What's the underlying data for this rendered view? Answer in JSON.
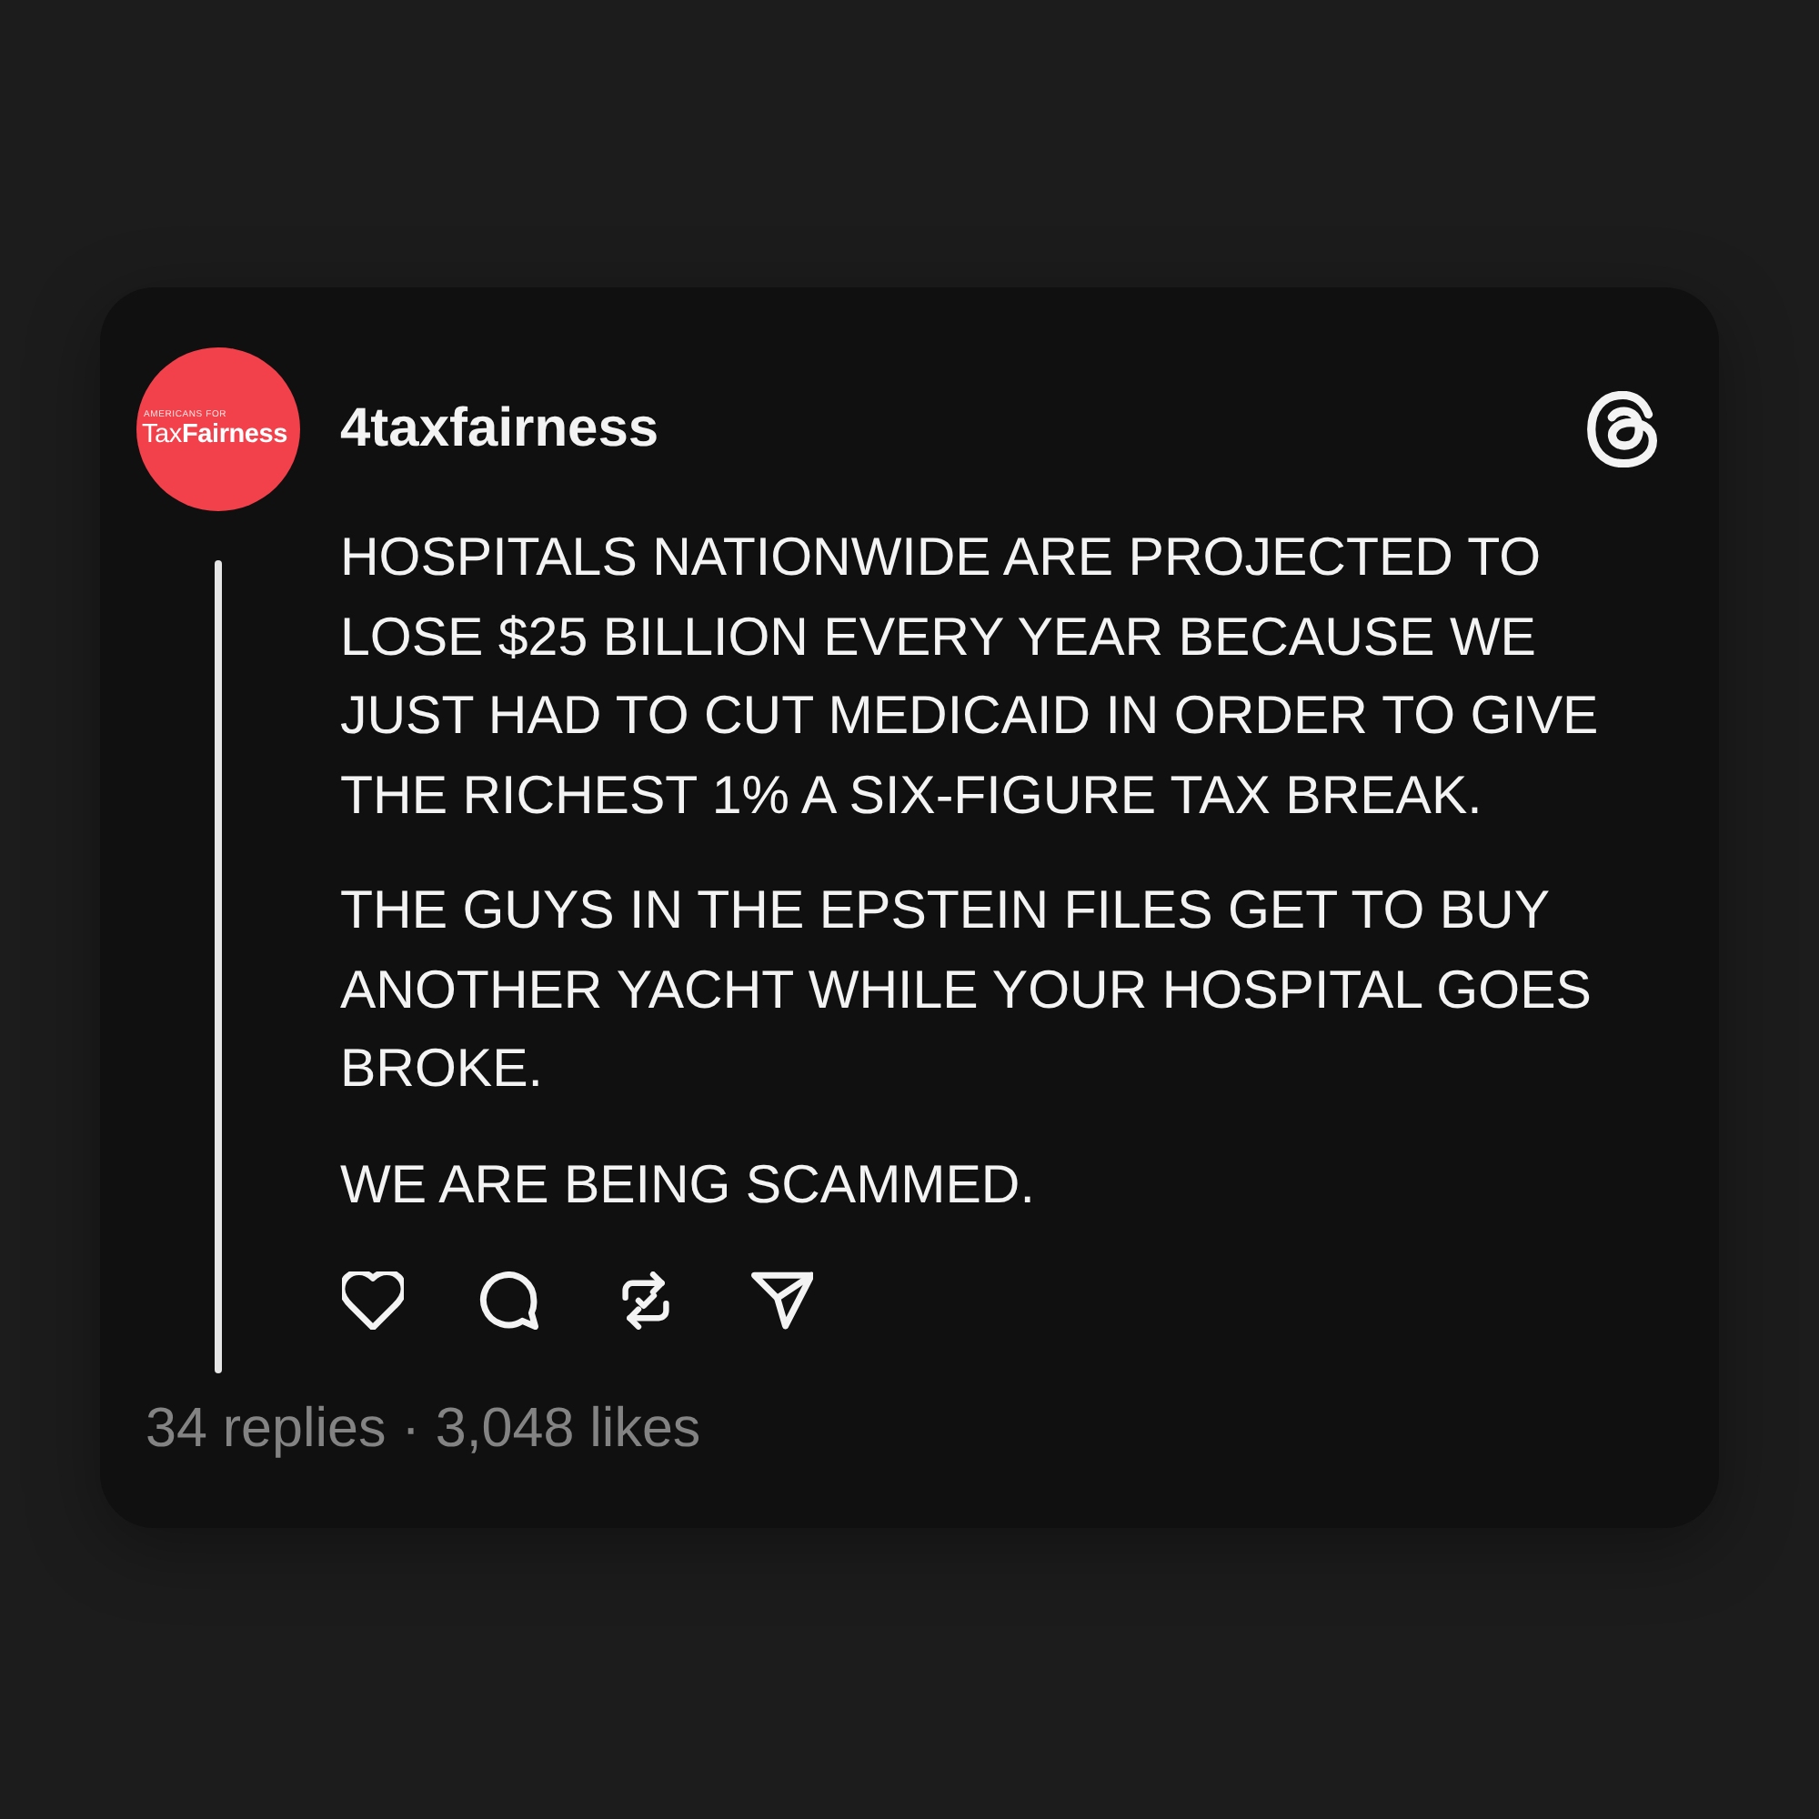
{
  "post": {
    "avatar": {
      "caption": "AMERICANS FOR",
      "logo": "Tax**Fairness**"
    },
    "username": "4taxfairness",
    "paragraphs": [
      "HOSPITALS NATIONWIDE ARE PROJECTED TO LOSE $25 BILLION EVERY YEAR BECAUSE WE JUST HAD TO CUT MEDICAID IN ORDER TO GIVE THE RICHEST 1% A SIX-FIGURE TAX BREAK.",
      "THE GUYS IN THE EPSTEIN FILES GET TO BUY ANOTHER YACHT WHILE YOUR HOSPITAL GOES BROKE.",
      "WE ARE BEING SCAMMED."
    ],
    "actions": [
      {
        "kind": "like"
      },
      {
        "kind": "reply"
      },
      {
        "kind": "repost"
      },
      {
        "kind": "share"
      }
    ],
    "stats": "34 replies · 3,048 likes"
  }
}
